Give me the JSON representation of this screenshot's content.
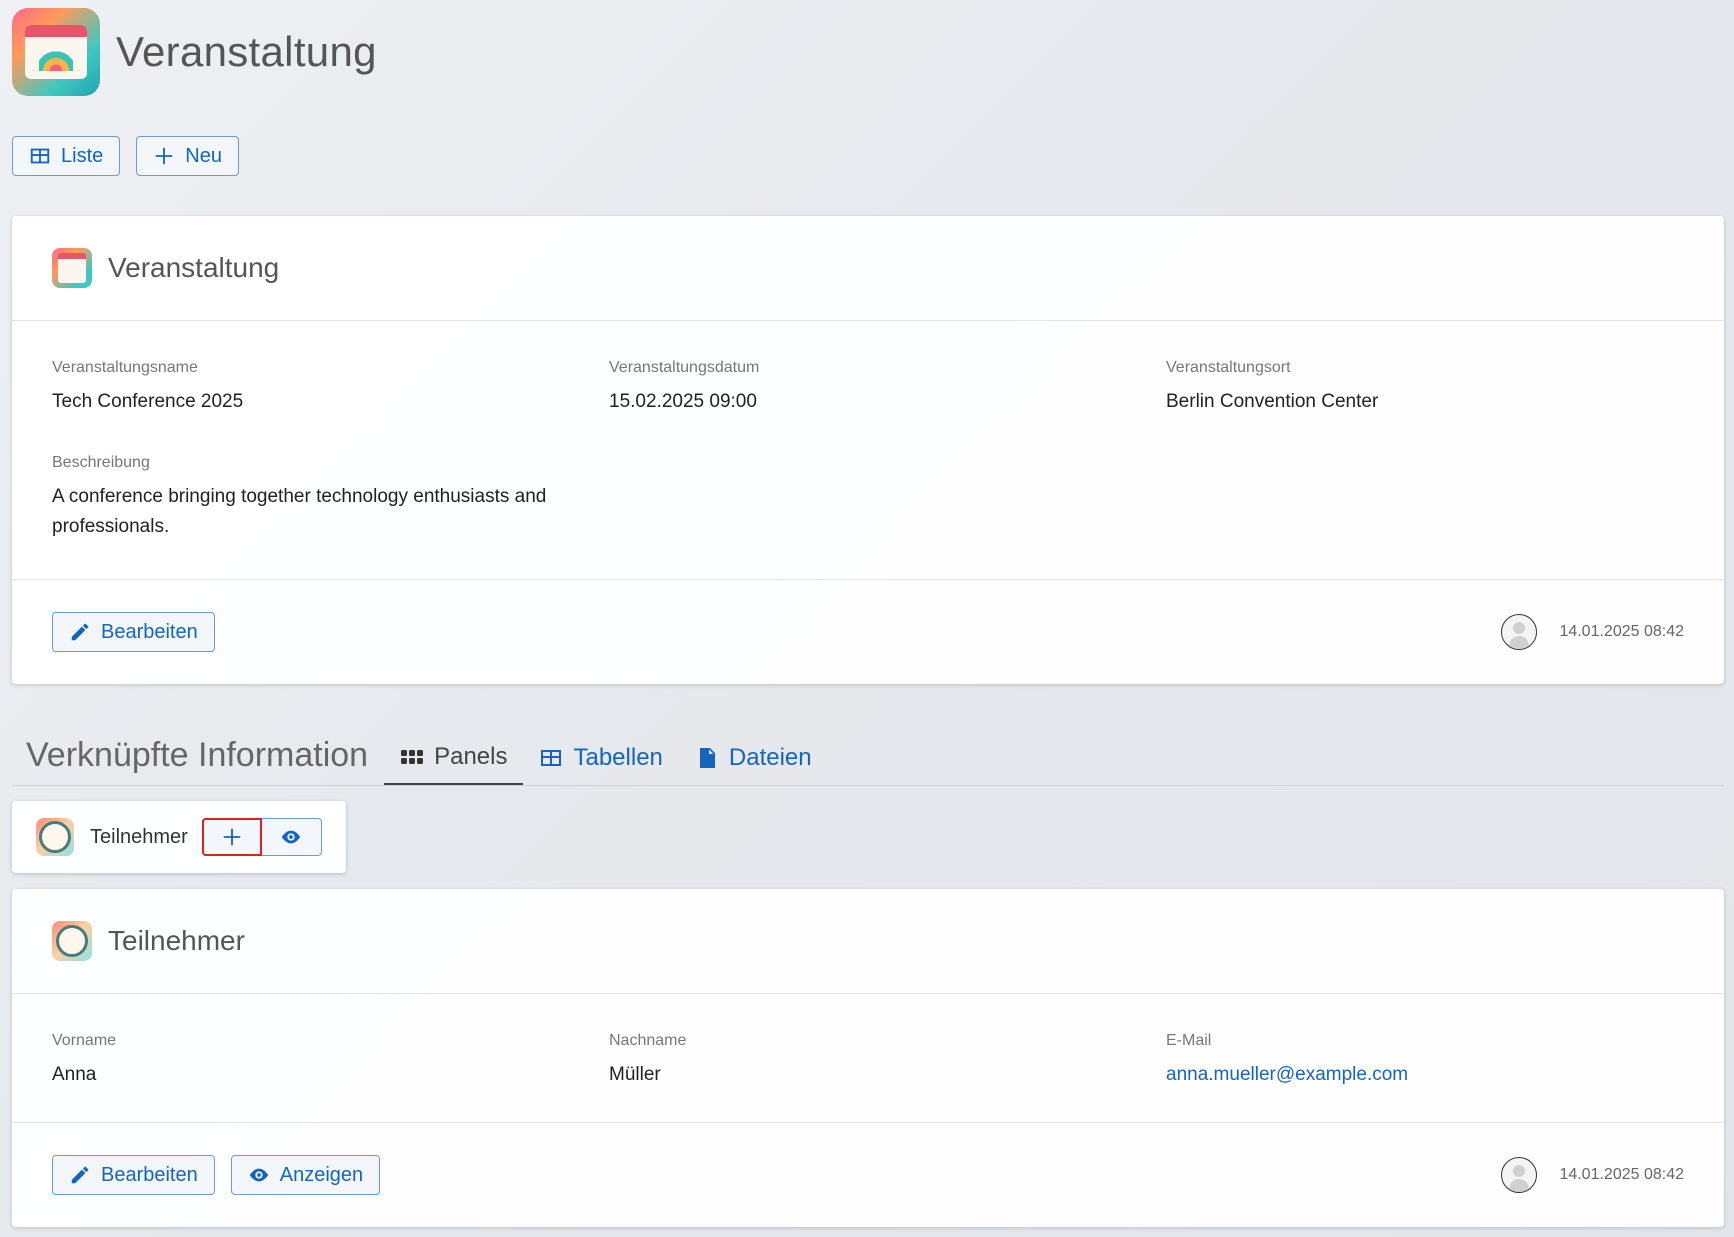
{
  "app": {
    "title": "Veranstaltung",
    "icon": "festival-calendar-icon"
  },
  "toolbar": {
    "list_label": "Liste",
    "new_label": "Neu"
  },
  "event_card": {
    "title": "Veranstaltung",
    "fields": {
      "name_label": "Veranstaltungsname",
      "name_value": "Tech Conference 2025",
      "date_label": "Veranstaltungsdatum",
      "date_value": "15.02.2025 09:00",
      "place_label": "Veranstaltungsort",
      "place_value": "Berlin Convention Center",
      "desc_label": "Beschreibung",
      "desc_value": "A conference bringing together technology enthusiasts and professionals."
    },
    "edit_label": "Bearbeiten",
    "timestamp": "14.01.2025 08:42"
  },
  "related": {
    "title": "Verknüpfte Information",
    "tabs": [
      {
        "label": "Panels",
        "icon": "grid-dots-icon",
        "active": true
      },
      {
        "label": "Tabellen",
        "icon": "table-icon",
        "active": false
      },
      {
        "label": "Dateien",
        "icon": "file-icon",
        "active": false
      }
    ],
    "mini_panel_label": "Teilnehmer"
  },
  "participant_card": {
    "title": "Teilnehmer",
    "fields": {
      "first_label": "Vorname",
      "first_value": "Anna",
      "last_label": "Nachname",
      "last_value": "Müller",
      "email_label": "E-Mail",
      "email_value": "anna.mueller@example.com"
    },
    "edit_label": "Bearbeiten",
    "view_label": "Anzeigen",
    "timestamp": "14.01.2025 08:42"
  },
  "colors": {
    "accent": "#1565c0",
    "highlight": "#e02020"
  }
}
